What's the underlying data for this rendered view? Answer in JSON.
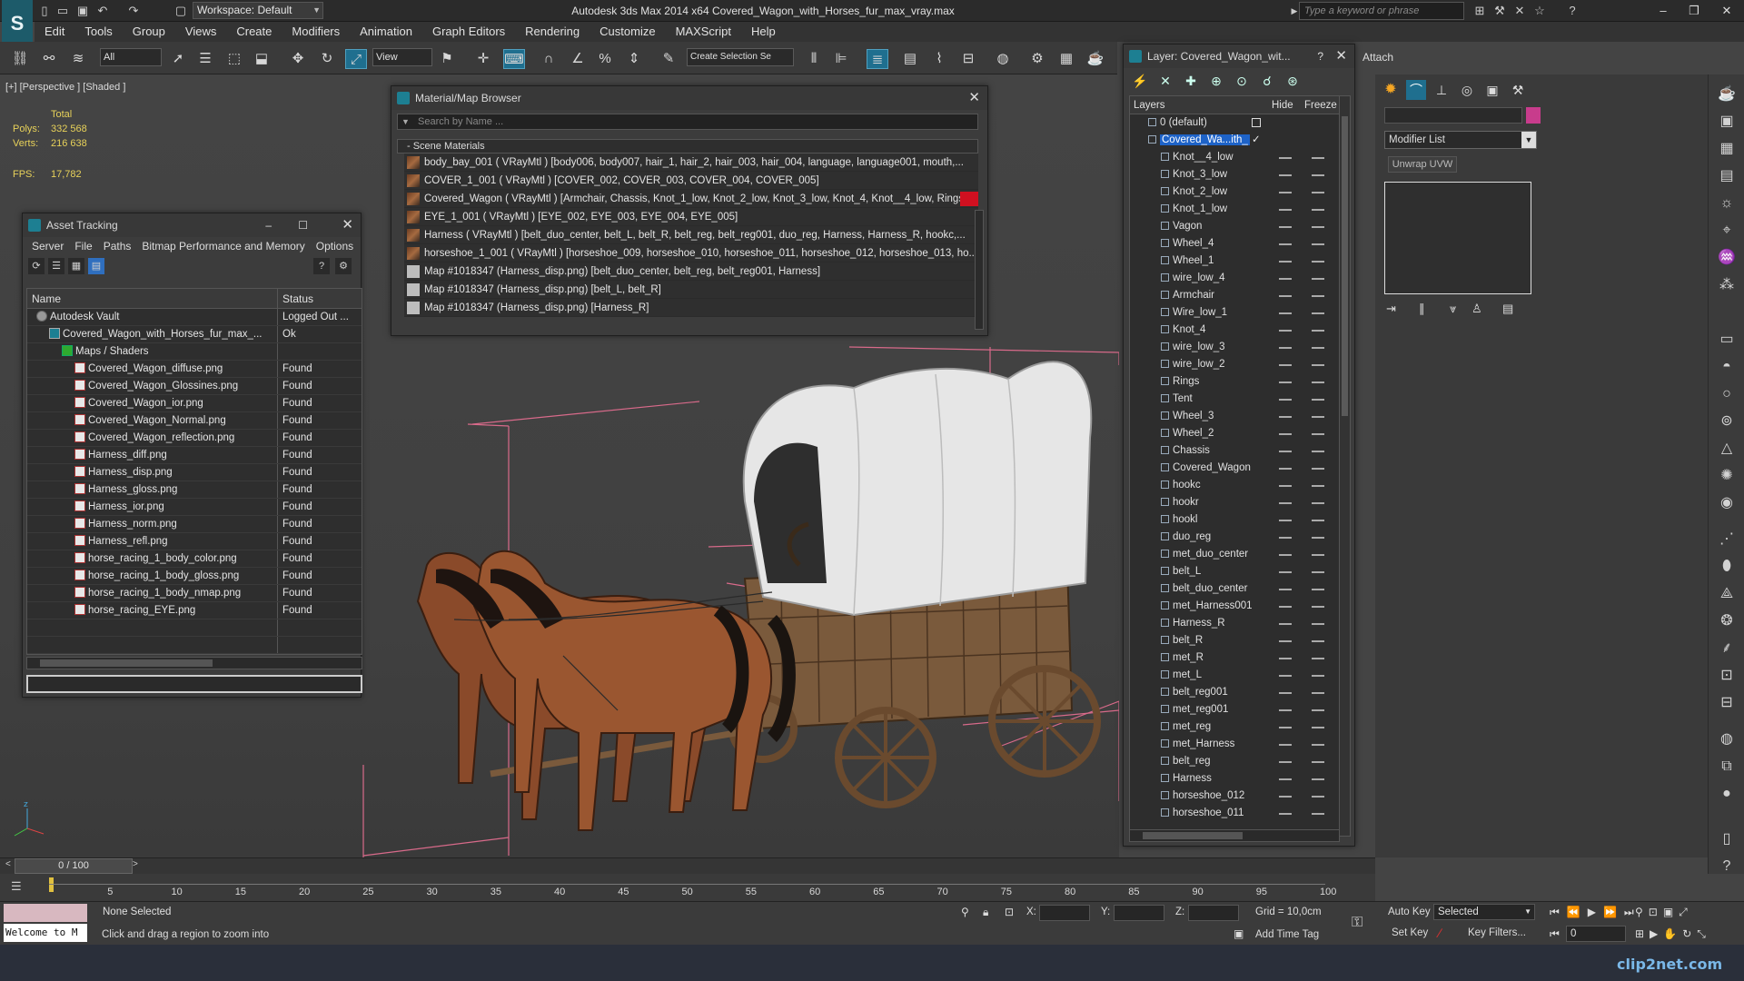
{
  "app": {
    "title": "Autodesk 3ds Max  2014 x64    Covered_Wagon_with_Horses_fur_max_vray.max",
    "workspace": "Workspace: Default",
    "search_placeholder": "Type a keyword or phrase"
  },
  "menu": [
    "Edit",
    "Tools",
    "Group",
    "Views",
    "Create",
    "Modifiers",
    "Animation",
    "Graph Editors",
    "Rendering",
    "Customize",
    "MAXScript",
    "Help"
  ],
  "toolbar": {
    "selection_filter": "All",
    "ref_coord": "View",
    "named_selection": "Create Selection Se",
    "attach_label": "Attach"
  },
  "viewport": {
    "label": "[+] [Perspective ] [Shaded ]",
    "stats_header": "Total",
    "polys_label": "Polys:",
    "polys_value": "332 568",
    "verts_label": "Verts:",
    "verts_value": "216 638",
    "fps_label": "FPS:",
    "fps_value": "17,782"
  },
  "material_browser": {
    "title": "Material/Map Browser",
    "search_placeholder": "Search by Name ...",
    "group": "- Scene Materials",
    "rows": [
      {
        "text": "body_bay_001  ( VRayMtl )  [body006, body007, hair_1, hair_2, hair_003, hair_004, language, language001, mouth,...",
        "kind": "tex"
      },
      {
        "text": "COVER_1_001  ( VRayMtl )  [COVER_002, COVER_003, COVER_004, COVER_005]",
        "kind": "tex"
      },
      {
        "text": "Covered_Wagon  ( VRayMtl )  [Armchair, Chassis, Knot_1_low, Knot_2_low, Knot_3_low, Knot_4, Knot__4_low, Rings...",
        "kind": "tex"
      },
      {
        "text": "EYE_1_001  ( VRayMtl )  [EYE_002, EYE_003, EYE_004, EYE_005]",
        "kind": "tex"
      },
      {
        "text": "Harness  ( VRayMtl )  [belt_duo_center, belt_L, belt_R, belt_reg, belt_reg001, duo_reg, Harness, Harness_R, hookc,...",
        "kind": "tex"
      },
      {
        "text": "horseshoe_1_001  ( VRayMtl )  [horseshoe_009, horseshoe_010, horseshoe_011, horseshoe_012, horseshoe_013, ho...",
        "kind": "tex"
      },
      {
        "text": "Map #1018347 (Harness_disp.png)  [belt_duo_center, belt_reg, belt_reg001, Harness]",
        "kind": "map"
      },
      {
        "text": "Map #1018347 (Harness_disp.png)  [belt_L, belt_R]",
        "kind": "map"
      },
      {
        "text": "Map #1018347 (Harness_disp.png)  [Harness_R]",
        "kind": "map"
      }
    ]
  },
  "asset_tracking": {
    "title": "Asset Tracking",
    "menu": [
      "Server",
      "File",
      "Paths",
      "Bitmap Performance and Memory",
      "Options"
    ],
    "col_name": "Name",
    "col_status": "Status",
    "rows": [
      {
        "name": "Autodesk Vault",
        "status": "Logged Out ...",
        "indent": 1,
        "icon": "vault"
      },
      {
        "name": "Covered_Wagon_with_Horses_fur_max_...",
        "status": "Ok",
        "indent": 2,
        "icon": "max"
      },
      {
        "name": "Maps / Shaders",
        "status": "",
        "indent": 3,
        "icon": "folder"
      },
      {
        "name": "Covered_Wagon_diffuse.png",
        "status": "Found",
        "indent": 4,
        "icon": "png"
      },
      {
        "name": "Covered_Wagon_Glossines.png",
        "status": "Found",
        "indent": 4,
        "icon": "png"
      },
      {
        "name": "Covered_Wagon_ior.png",
        "status": "Found",
        "indent": 4,
        "icon": "png"
      },
      {
        "name": "Covered_Wagon_Normal.png",
        "status": "Found",
        "indent": 4,
        "icon": "png"
      },
      {
        "name": "Covered_Wagon_reflection.png",
        "status": "Found",
        "indent": 4,
        "icon": "png"
      },
      {
        "name": "Harness_diff.png",
        "status": "Found",
        "indent": 4,
        "icon": "png"
      },
      {
        "name": "Harness_disp.png",
        "status": "Found",
        "indent": 4,
        "icon": "png"
      },
      {
        "name": "Harness_gloss.png",
        "status": "Found",
        "indent": 4,
        "icon": "png"
      },
      {
        "name": "Harness_ior.png",
        "status": "Found",
        "indent": 4,
        "icon": "png"
      },
      {
        "name": "Harness_norm.png",
        "status": "Found",
        "indent": 4,
        "icon": "png"
      },
      {
        "name": "Harness_refl.png",
        "status": "Found",
        "indent": 4,
        "icon": "png"
      },
      {
        "name": "horse_racing_1_body_color.png",
        "status": "Found",
        "indent": 4,
        "icon": "png"
      },
      {
        "name": "horse_racing_1_body_gloss.png",
        "status": "Found",
        "indent": 4,
        "icon": "png"
      },
      {
        "name": "horse_racing_1_body_nmap.png",
        "status": "Found",
        "indent": 4,
        "icon": "png"
      },
      {
        "name": "horse_racing_EYE.png",
        "status": "Found",
        "indent": 4,
        "icon": "png"
      }
    ]
  },
  "layer_explorer": {
    "title": "Layer: Covered_Wagon_wit...",
    "col_layers": "Layers",
    "col_hide": "Hide",
    "col_freeze": "Freeze",
    "default_layer": "0 (default)",
    "active_layer": "Covered_Wa...ith_",
    "objects": [
      "Knot__4_low",
      "Knot_3_low",
      "Knot_2_low",
      "Knot_1_low",
      "Vagon",
      "Wheel_4",
      "Wheel_1",
      "wire_low_4",
      "Armchair",
      "Wire_low_1",
      "Knot_4",
      "wire_low_3",
      "wire_low_2",
      "Rings",
      "Tent",
      "Wheel_3",
      "Wheel_2",
      "Chassis",
      "Covered_Wagon",
      "hookc",
      "hookr",
      "hookl",
      "duo_reg",
      "met_duo_center",
      "belt_L",
      "belt_duo_center",
      "met_Harness001",
      "Harness_R",
      "belt_R",
      "met_R",
      "met_L",
      "belt_reg001",
      "met_reg001",
      "met_reg",
      "met_Harness",
      "belt_reg",
      "Harness",
      "horseshoe_012",
      "horseshoe_011"
    ]
  },
  "command_panel": {
    "modifier_list": "Modifier List",
    "unwrap_button": "Unwrap UVW",
    "color_swatch": "#c83c8c"
  },
  "timeline": {
    "frame_display": "0 / 100",
    "ticks": [
      "5",
      "10",
      "15",
      "20",
      "25",
      "30",
      "35",
      "40",
      "45",
      "50",
      "55",
      "60",
      "65",
      "70",
      "75",
      "80",
      "85",
      "90",
      "95",
      "100"
    ]
  },
  "status": {
    "maxscript_listener": "Welcome to M",
    "selection": "None Selected",
    "prompt": "Click and drag a region to zoom into",
    "x_label": "X:",
    "y_label": "Y:",
    "z_label": "Z:",
    "grid": "Grid = 10,0cm",
    "add_time_tag": "Add Time Tag",
    "auto_key": "Auto Key",
    "set_key": "Set Key",
    "key_mode": "Selected",
    "key_filters": "Key Filters...",
    "frame_field": "0"
  },
  "watermark": "clip2net.com"
}
